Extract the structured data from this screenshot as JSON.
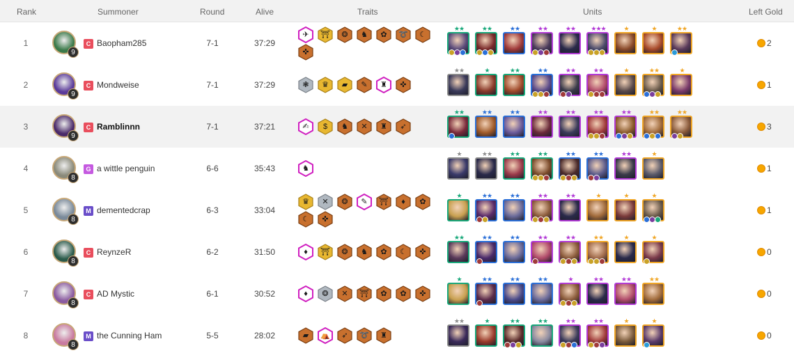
{
  "header": {
    "rank": "Rank",
    "summoner": "Summoner",
    "round": "Round",
    "alive": "Alive",
    "traits": "Traits",
    "units": "Units",
    "gold": "Left Gold"
  },
  "colors": {
    "tier_C": "#e94e5d",
    "tier_G": "#c55ae0",
    "tier_M": "#6a4ec9",
    "trait_bronze": "#c8702e",
    "trait_gold": "#e8b730",
    "trait_silver": "#b0b8c0",
    "trait_chromatic": "#e02ec8",
    "cost1": "#8a8a8a",
    "cost2": "#18a87a",
    "cost3": "#2a6fd8",
    "cost4": "#b23ad6",
    "cost5": "#f0a626",
    "star_gray": "#8c8c8c",
    "star_green": "#18a87a",
    "star_blue": "#2a6fd8",
    "star_purple": "#b23ad6",
    "star_gold": "#f0a626",
    "gold_coin": "#f7a600"
  },
  "rows": [
    {
      "rank": "1",
      "name": "Baopham285",
      "tier": "C",
      "level": "9",
      "round": "7-1",
      "alive": "37:29",
      "gold": "2",
      "avatar": "#3b7a4a",
      "bold": false,
      "highlight": false,
      "traits": [
        {
          "tier": "chromatic",
          "glyph": "✈"
        },
        {
          "tier": "gold",
          "glyph": "⛩"
        },
        {
          "tier": "bronze",
          "glyph": "❂"
        },
        {
          "tier": "bronze",
          "glyph": "♞"
        },
        {
          "tier": "bronze",
          "glyph": "✿"
        },
        {
          "tier": "bronze",
          "glyph": "➰"
        },
        {
          "tier": "bronze",
          "glyph": "☾"
        },
        {
          "tier": "bronze",
          "glyph": "✜"
        }
      ],
      "units": [
        {
          "cost": "cost2",
          "stars": "★★",
          "star": "star_green",
          "art": "#5a4a7a",
          "items": [
            "#c9a227",
            "#7a3e9e",
            "#2a6fd8"
          ]
        },
        {
          "cost": "cost2",
          "stars": "★★",
          "star": "star_green",
          "art": "#7a2a2a",
          "items": [
            "#c9a227",
            "#2a6fd8",
            "#c9a227"
          ]
        },
        {
          "cost": "cost3",
          "stars": "★★",
          "star": "star_blue",
          "art": "#a03a3a",
          "items": []
        },
        {
          "cost": "cost4",
          "stars": "★★",
          "star": "star_purple",
          "art": "#4a3a5a",
          "items": [
            "#c9a227",
            "#7a3e9e",
            "#a03a3a"
          ]
        },
        {
          "cost": "cost4",
          "stars": "★★",
          "star": "star_purple",
          "art": "#2a2a4a",
          "items": []
        },
        {
          "cost": "cost4",
          "stars": "★★★",
          "star": "star_purple",
          "art": "#4a4a6a",
          "items": [
            "#c9a227",
            "#c9a227",
            "#c9a227"
          ]
        },
        {
          "cost": "cost5",
          "stars": "★",
          "star": "star_gold",
          "art": "#8a4a2a",
          "items": []
        },
        {
          "cost": "cost5",
          "stars": "★",
          "star": "star_gold",
          "art": "#a84a2a",
          "items": []
        },
        {
          "cost": "cost5",
          "stars": "★★",
          "star": "star_gold",
          "art": "#5a3a5a",
          "items": [
            "#2a9ad8"
          ]
        }
      ]
    },
    {
      "rank": "2",
      "name": "Mondweise",
      "tier": "C",
      "level": "9",
      "round": "7-1",
      "alive": "37:29",
      "gold": "1",
      "avatar": "#5a3a9a",
      "bold": false,
      "highlight": false,
      "traits": [
        {
          "tier": "silver",
          "glyph": "❃"
        },
        {
          "tier": "gold",
          "glyph": "♛"
        },
        {
          "tier": "gold",
          "glyph": "▰"
        },
        {
          "tier": "bronze",
          "glyph": "✎"
        },
        {
          "tier": "chromatic",
          "glyph": "♜"
        },
        {
          "tier": "bronze",
          "glyph": "✜"
        }
      ],
      "units": [
        {
          "cost": "cost1",
          "stars": "★★",
          "star": "star_gray",
          "art": "#3a3a5a",
          "items": []
        },
        {
          "cost": "cost2",
          "stars": "★",
          "star": "star_green",
          "art": "#8a3a2a",
          "items": []
        },
        {
          "cost": "cost2",
          "stars": "★★",
          "star": "star_green",
          "art": "#a04a2a",
          "items": []
        },
        {
          "cost": "cost3",
          "stars": "★★",
          "star": "star_blue",
          "art": "#5a4a8a",
          "items": [
            "#c9a227",
            "#c9a227",
            "#a03a3a"
          ]
        },
        {
          "cost": "cost4",
          "stars": "★★",
          "star": "star_purple",
          "art": "#3a3a4a",
          "items": [
            "#a03a3a",
            "#7a3e9e"
          ]
        },
        {
          "cost": "cost4",
          "stars": "★★",
          "star": "star_purple",
          "art": "#b04a6a",
          "items": [
            "#c9a227",
            "#a03a3a",
            "#a03a3a"
          ]
        },
        {
          "cost": "cost5",
          "stars": "★",
          "star": "star_gold",
          "art": "#5a4a4a",
          "items": []
        },
        {
          "cost": "cost5",
          "stars": "★★",
          "star": "star_gold",
          "art": "#6a5a4a",
          "items": [
            "#2a6fd8",
            "#7a3e9e",
            "#c9a227"
          ]
        },
        {
          "cost": "cost5",
          "stars": "★",
          "star": "star_gold",
          "art": "#7a3a6a",
          "items": []
        }
      ]
    },
    {
      "rank": "3",
      "name": "Ramblinnn",
      "tier": "C",
      "level": "9",
      "round": "7-1",
      "alive": "37:21",
      "gold": "3",
      "avatar": "#4a2a6a",
      "bold": true,
      "highlight": true,
      "traits": [
        {
          "tier": "chromatic",
          "glyph": "✍"
        },
        {
          "tier": "gold",
          "glyph": "$"
        },
        {
          "tier": "bronze",
          "glyph": "♞"
        },
        {
          "tier": "bronze",
          "glyph": "✕"
        },
        {
          "tier": "bronze",
          "glyph": "♜"
        },
        {
          "tier": "bronze",
          "glyph": "➶"
        }
      ],
      "units": [
        {
          "cost": "cost2",
          "stars": "★★",
          "star": "star_green",
          "art": "#7a2a3a",
          "items": [
            "#2a6fd8"
          ]
        },
        {
          "cost": "cost3",
          "stars": "★★",
          "star": "star_blue",
          "art": "#a05a2a",
          "items": []
        },
        {
          "cost": "cost3",
          "stars": "★★",
          "star": "star_blue",
          "art": "#6a5a9a",
          "items": []
        },
        {
          "cost": "cost4",
          "stars": "★★",
          "star": "star_purple",
          "art": "#6a2a3a",
          "items": []
        },
        {
          "cost": "cost4",
          "stars": "★★",
          "star": "star_purple",
          "art": "#3a3a5a",
          "items": []
        },
        {
          "cost": "cost4",
          "stars": "★★",
          "star": "star_purple",
          "art": "#a03a3a",
          "items": [
            "#c9a227",
            "#c9a227",
            "#a03a3a"
          ]
        },
        {
          "cost": "cost4",
          "stars": "★★",
          "star": "star_purple",
          "art": "#8a5a2a",
          "items": [
            "#2a6fd8",
            "#7a3e9e",
            "#c9a227"
          ]
        },
        {
          "cost": "cost5",
          "stars": "★★",
          "star": "star_gold",
          "art": "#a06a3a",
          "items": [
            "#2a6fd8",
            "#c9a227",
            "#2a6fd8"
          ]
        },
        {
          "cost": "cost5",
          "stars": "★★",
          "star": "star_gold",
          "art": "#8a5a3a",
          "items": [
            "#7a3e9e",
            "#c9a227"
          ]
        }
      ]
    },
    {
      "rank": "4",
      "name": "a wittle penguin",
      "tier": "G",
      "level": "8",
      "round": "6-6",
      "alive": "35:43",
      "gold": "1",
      "avatar": "#8a8a7a",
      "bold": false,
      "highlight": false,
      "traits": [
        {
          "tier": "chromatic",
          "glyph": "♞"
        }
      ],
      "units": [
        {
          "cost": "cost1",
          "stars": "★",
          "star": "star_gray",
          "art": "#3a3a6a",
          "items": []
        },
        {
          "cost": "cost1",
          "stars": "★★",
          "star": "star_gray",
          "art": "#2a2a4a",
          "items": []
        },
        {
          "cost": "cost2",
          "stars": "★★",
          "star": "star_green",
          "art": "#9a3a4a",
          "items": []
        },
        {
          "cost": "cost2",
          "stars": "★★",
          "star": "star_green",
          "art": "#7a4a2a",
          "items": [
            "#c9a227",
            "#c9a227",
            "#a03a3a"
          ]
        },
        {
          "cost": "cost3",
          "stars": "★★",
          "star": "star_blue",
          "art": "#4a2a2a",
          "items": [
            "#c9a227",
            "#a03a3a",
            "#c9a227"
          ]
        },
        {
          "cost": "cost3",
          "stars": "★★",
          "star": "star_blue",
          "art": "#5a5a8a",
          "items": [
            "#a03a3a",
            "#7a3e9e"
          ]
        },
        {
          "cost": "cost4",
          "stars": "★★",
          "star": "star_purple",
          "art": "#3a3a4a",
          "items": []
        },
        {
          "cost": "cost5",
          "stars": "★",
          "star": "star_gold",
          "art": "#5a5a6a",
          "items": []
        }
      ]
    },
    {
      "rank": "5",
      "name": "dementedcrap",
      "tier": "M",
      "level": "8",
      "round": "6-3",
      "alive": "33:04",
      "gold": "1",
      "avatar": "#7a8a9a",
      "bold": false,
      "highlight": false,
      "traits": [
        {
          "tier": "gold",
          "glyph": "♛"
        },
        {
          "tier": "silver",
          "glyph": "✕"
        },
        {
          "tier": "bronze",
          "glyph": "❂"
        },
        {
          "tier": "chromatic",
          "glyph": "✎"
        },
        {
          "tier": "bronze",
          "glyph": "⛩"
        },
        {
          "tier": "bronze",
          "glyph": "♦"
        },
        {
          "tier": "bronze",
          "glyph": "✿"
        },
        {
          "tier": "bronze",
          "glyph": "☾"
        },
        {
          "tier": "bronze",
          "glyph": "✜"
        }
      ],
      "units": [
        {
          "cost": "cost2",
          "stars": "★",
          "star": "star_green",
          "art": "#c8a050",
          "items": []
        },
        {
          "cost": "cost3",
          "stars": "★★",
          "star": "star_blue",
          "art": "#5a2a6a",
          "items": [
            "#a03a3a",
            "#c9a227"
          ]
        },
        {
          "cost": "cost3",
          "stars": "★★",
          "star": "star_blue",
          "art": "#6a6a9a",
          "items": []
        },
        {
          "cost": "cost4",
          "stars": "★★",
          "star": "star_purple",
          "art": "#8a5a3a",
          "items": [
            "#c9a227",
            "#a03a3a",
            "#c9a227"
          ]
        },
        {
          "cost": "cost4",
          "stars": "★★",
          "star": "star_purple",
          "art": "#2a2a4a",
          "items": []
        },
        {
          "cost": "cost5",
          "stars": "★",
          "star": "star_gold",
          "art": "#a06a3a",
          "items": []
        },
        {
          "cost": "cost5",
          "stars": "★",
          "star": "star_gold",
          "art": "#7a3a3a",
          "items": []
        },
        {
          "cost": "cost5",
          "stars": "★",
          "star": "star_gold",
          "art": "#6a5a4a",
          "items": [
            "#2a6fd8",
            "#7a3e9e",
            "#18a87a"
          ]
        }
      ]
    },
    {
      "rank": "6",
      "name": "ReynzeR",
      "tier": "C",
      "level": "8",
      "round": "6-2",
      "alive": "31:50",
      "gold": "0",
      "avatar": "#2a5a4a",
      "bold": false,
      "highlight": false,
      "traits": [
        {
          "tier": "chromatic",
          "glyph": "♦"
        },
        {
          "tier": "gold",
          "glyph": "⛩"
        },
        {
          "tier": "bronze",
          "glyph": "❂"
        },
        {
          "tier": "bronze",
          "glyph": "♞"
        },
        {
          "tier": "bronze",
          "glyph": "✿"
        },
        {
          "tier": "bronze",
          "glyph": "☾"
        },
        {
          "tier": "bronze",
          "glyph": "✜"
        }
      ],
      "units": [
        {
          "cost": "cost2",
          "stars": "★★",
          "star": "star_green",
          "art": "#5a3a5a",
          "items": []
        },
        {
          "cost": "cost3",
          "stars": "★★",
          "star": "star_blue",
          "art": "#4a2a6a",
          "items": [
            "#a03a3a"
          ]
        },
        {
          "cost": "cost3",
          "stars": "★★",
          "star": "star_blue",
          "art": "#6a6a9a",
          "items": []
        },
        {
          "cost": "cost4",
          "stars": "★★",
          "star": "star_purple",
          "art": "#b04a6a",
          "items": [
            "#a03a3a"
          ]
        },
        {
          "cost": "cost4",
          "stars": "★★",
          "star": "star_purple",
          "art": "#8a5a3a",
          "items": [
            "#c9a227",
            "#a03a3a",
            "#c9a227"
          ]
        },
        {
          "cost": "cost5",
          "stars": "★★",
          "star": "star_gold",
          "art": "#a06a4a",
          "items": [
            "#c9a227",
            "#c9a227",
            "#a03a3a"
          ]
        },
        {
          "cost": "cost5",
          "stars": "★",
          "star": "star_gold",
          "art": "#2a2a4a",
          "items": []
        },
        {
          "cost": "cost5",
          "stars": "★",
          "star": "star_gold",
          "art": "#7a3a4a",
          "items": [
            "#c9a227"
          ]
        }
      ]
    },
    {
      "rank": "7",
      "name": "AD Mystic",
      "tier": "C",
      "level": "8",
      "round": "6-1",
      "alive": "30:52",
      "gold": "0",
      "avatar": "#8a5aa0",
      "bold": false,
      "highlight": false,
      "traits": [
        {
          "tier": "chromatic",
          "glyph": "♦"
        },
        {
          "tier": "silver",
          "glyph": "❂"
        },
        {
          "tier": "bronze",
          "glyph": "✕"
        },
        {
          "tier": "bronze",
          "glyph": "⛩"
        },
        {
          "tier": "bronze",
          "glyph": "✿"
        },
        {
          "tier": "bronze",
          "glyph": "✿"
        },
        {
          "tier": "bronze",
          "glyph": "✜"
        }
      ],
      "units": [
        {
          "cost": "cost2",
          "stars": "★",
          "star": "star_green",
          "art": "#c8a050",
          "items": []
        },
        {
          "cost": "cost3",
          "stars": "★★",
          "star": "star_blue",
          "art": "#5a2a4a",
          "items": [
            "#a03a3a"
          ]
        },
        {
          "cost": "cost3",
          "stars": "★★",
          "star": "star_blue",
          "art": "#4a4a8a",
          "items": []
        },
        {
          "cost": "cost3",
          "stars": "★★",
          "star": "star_blue",
          "art": "#6a6a9a",
          "items": []
        },
        {
          "cost": "cost4",
          "stars": "★",
          "star": "star_purple",
          "art": "#8a5a3a",
          "items": [
            "#c9a227",
            "#a03a3a",
            "#c9a227"
          ]
        },
        {
          "cost": "cost4",
          "stars": "★★",
          "star": "star_purple",
          "art": "#2a2a4a",
          "items": []
        },
        {
          "cost": "cost4",
          "stars": "★★",
          "star": "star_purple",
          "art": "#b04a6a",
          "items": []
        },
        {
          "cost": "cost5",
          "stars": "★★",
          "star": "star_gold",
          "art": "#a06a3a",
          "items": []
        }
      ]
    },
    {
      "rank": "8",
      "name": "the Cunning Ham",
      "tier": "M",
      "level": "8",
      "round": "5-5",
      "alive": "28:02",
      "gold": "0",
      "avatar": "#c87aa0",
      "bold": false,
      "highlight": false,
      "traits": [
        {
          "tier": "bronze",
          "glyph": "▰"
        },
        {
          "tier": "chromatic",
          "glyph": "⛺"
        },
        {
          "tier": "bronze",
          "glyph": "➶"
        },
        {
          "tier": "bronze",
          "glyph": "➰"
        },
        {
          "tier": "bronze",
          "glyph": "♜"
        }
      ],
      "units": [
        {
          "cost": "cost1",
          "stars": "★★",
          "star": "star_gray",
          "art": "#3a2a5a",
          "items": []
        },
        {
          "cost": "cost2",
          "stars": "★",
          "star": "star_green",
          "art": "#9a3a2a",
          "items": []
        },
        {
          "cost": "cost2",
          "stars": "★★",
          "star": "star_green",
          "art": "#5a2a2a",
          "items": [
            "#a03a3a",
            "#7a3e9e",
            "#c9a227"
          ]
        },
        {
          "cost": "cost2",
          "stars": "★★",
          "star": "star_green",
          "art": "#8a8aa0",
          "items": []
        },
        {
          "cost": "cost4",
          "stars": "★★",
          "star": "star_purple",
          "art": "#3a3a5a",
          "items": [
            "#c9a227",
            "#a03a3a",
            "#2a6fd8"
          ]
        },
        {
          "cost": "cost4",
          "stars": "★★",
          "star": "star_purple",
          "art": "#a03a3a",
          "items": [
            "#c9a227",
            "#a03a3a",
            "#7a3e9e"
          ]
        },
        {
          "cost": "cost5",
          "stars": "★",
          "star": "star_gold",
          "art": "#7a5a3a",
          "items": []
        },
        {
          "cost": "cost5",
          "stars": "★",
          "star": "star_gold",
          "art": "#5a3a6a",
          "items": [
            "#2a9ad8"
          ]
        }
      ]
    }
  ]
}
